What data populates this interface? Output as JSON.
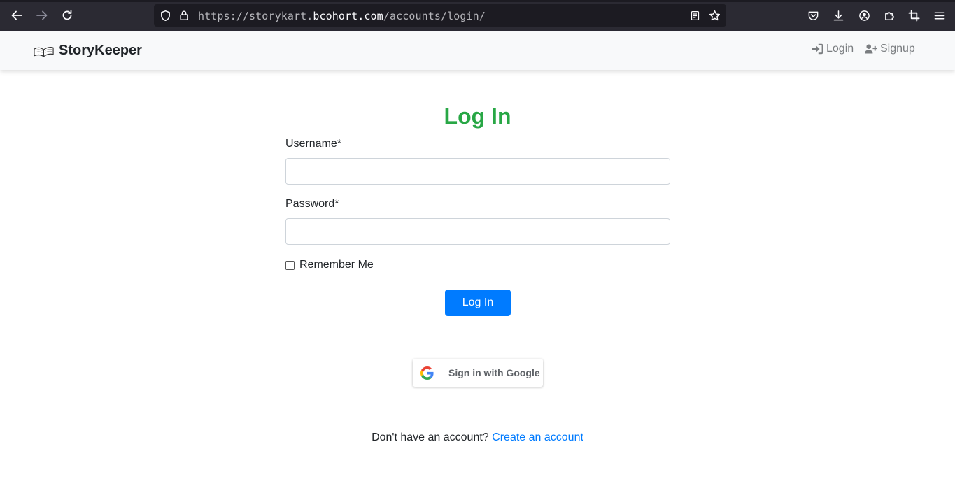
{
  "browser": {
    "url_prefix": "https://storykart.",
    "url_host": "bcohort.com",
    "url_path": "/accounts/login/",
    "icons": {
      "back": "back-arrow-icon",
      "forward": "forward-arrow-icon",
      "reload": "reload-icon",
      "shield": "tracking-shield-icon",
      "lock": "lock-icon",
      "reader": "reader-view-icon",
      "bookmark": "star-icon",
      "pocket": "pocket-icon",
      "downloads": "download-icon",
      "account": "account-icon",
      "extensions": "extensions-icon",
      "crop": "screenshot-crop-icon",
      "menu": "hamburger-menu-icon"
    }
  },
  "navbar": {
    "brand": "StoryKeeper",
    "links": [
      {
        "label": "Login",
        "icon": "sign-in-icon"
      },
      {
        "label": "Signup",
        "icon": "user-plus-icon"
      }
    ]
  },
  "form": {
    "title": "Log In",
    "username_label": "Username*",
    "username_value": "",
    "password_label": "Password*",
    "password_value": "",
    "remember_label": "Remember Me",
    "remember_checked": false,
    "submit_label": "Log In"
  },
  "google": {
    "label": "Sign in with Google",
    "icon": "google-g-icon"
  },
  "footer": {
    "prompt": "Don't have an account?",
    "link": "Create an account"
  },
  "colors": {
    "title_green": "#28a745",
    "primary_blue": "#007bff",
    "browser_dark": "#2b2a33",
    "navbar_bg": "#f8f9fa"
  }
}
